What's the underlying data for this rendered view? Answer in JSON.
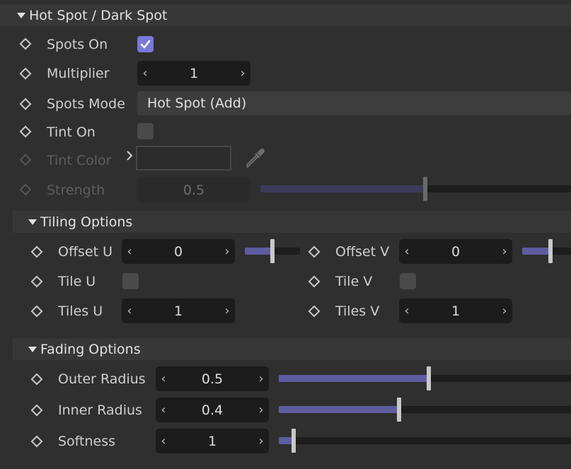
{
  "sections": {
    "hotspot": {
      "title": "Hot Spot / Dark Spot"
    },
    "tiling": {
      "title": "Tiling Options"
    },
    "fading": {
      "title": "Fading Options"
    }
  },
  "hotspot": {
    "spots_on": {
      "label": "Spots On",
      "checked": true
    },
    "multiplier": {
      "label": "Multiplier",
      "value": "1"
    },
    "spots_mode": {
      "label": "Spots Mode",
      "value": "Hot Spot (Add)"
    },
    "tint_on": {
      "label": "Tint On",
      "checked": false
    },
    "tint_color": {
      "label": "Tint Color",
      "color": "#2c2c2c"
    },
    "strength": {
      "label": "Strength",
      "value": "0.5",
      "slider_fraction": 0.53
    }
  },
  "tiling": {
    "offset_u": {
      "label": "Offset U",
      "value": "0",
      "slider_fraction": 0.5
    },
    "offset_v": {
      "label": "Offset V",
      "value": "0",
      "slider_fraction": 0.5
    },
    "tile_u": {
      "label": "Tile U",
      "checked": false
    },
    "tile_v": {
      "label": "Tile V",
      "checked": false
    },
    "tiles_u": {
      "label": "Tiles U",
      "value": "1"
    },
    "tiles_v": {
      "label": "Tiles V",
      "value": "1"
    }
  },
  "fading": {
    "outer_radius": {
      "label": "Outer Radius",
      "value": "0.5",
      "slider_fraction": 0.5
    },
    "inner_radius": {
      "label": "Inner Radius",
      "value": "0.4",
      "slider_fraction": 0.4
    },
    "softness": {
      "label": "Softness",
      "value": "1",
      "slider_fraction": 0.05
    }
  },
  "icons": {
    "keyframe": "diamond-keyframe-icon",
    "expand": "chevron-right-icon",
    "picker": "eyedropper-icon",
    "collapse": "triangle-down-icon"
  },
  "colors": {
    "background": "#2f2f2f",
    "header": "#373737",
    "accent": "#7b78d8",
    "slider_fill": "#5f5ca0"
  }
}
